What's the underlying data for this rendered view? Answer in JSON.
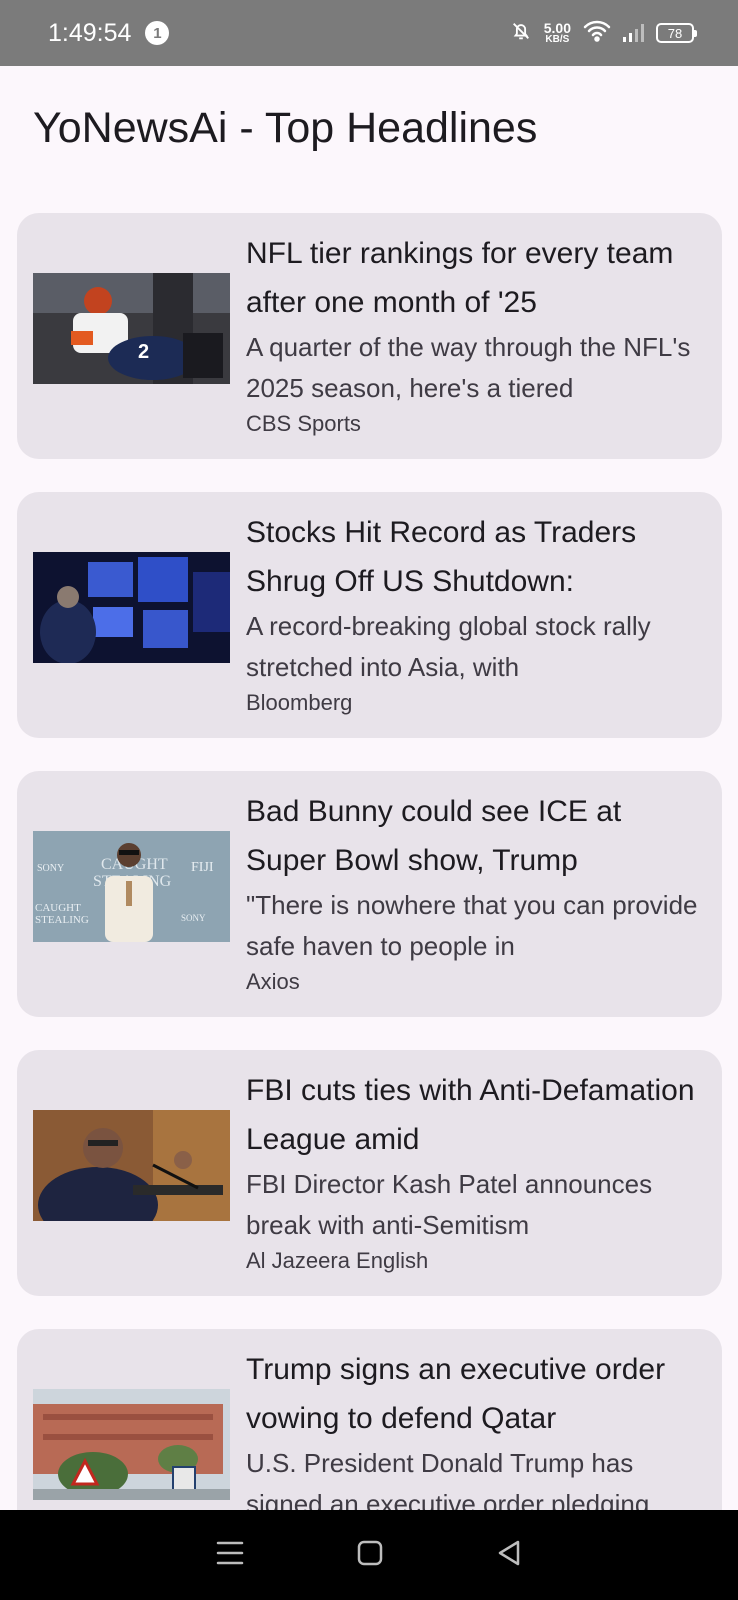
{
  "status_bar": {
    "time": "1:49:54",
    "notification_count": "1",
    "net_speed_value": "5.00",
    "net_speed_unit": "KB/S",
    "battery": "78"
  },
  "app": {
    "title": "YoNewsAi - Top Headlines"
  },
  "articles": [
    {
      "headline": "NFL tier rankings for every team after one month of '25",
      "description": "A quarter of the way through the NFL's 2025 season, here's a tiered",
      "source": "CBS Sports",
      "image": "football-players"
    },
    {
      "headline": "Stocks Hit Record as Traders Shrug Off US Shutdown:",
      "description": "A record-breaking global stock rally stretched into Asia, with",
      "source": "Bloomberg",
      "image": "trading-floor"
    },
    {
      "headline": "Bad Bunny could see ICE at Super Bowl show, Trump",
      "description": "\"There is nowhere that you can provide safe haven to people in",
      "source": "Axios",
      "image": "red-carpet",
      "image_text": {
        "brand_1": "SONY",
        "brand_2": "SONY",
        "brand_3": "FIJI",
        "movie_1": "CAUGHT",
        "movie_2": "STEALING"
      }
    },
    {
      "headline": "FBI cuts ties with Anti-Defamation League amid",
      "description": "FBI Director Kash Patel announces break with anti-Semitism",
      "source": "Al Jazeera English",
      "image": "speaker-at-hearing"
    },
    {
      "headline": "Trump signs an executive order vowing to defend Qatar",
      "description": "U.S. President Donald Trump has signed an executive order pledging",
      "source": "",
      "image": "city-street"
    }
  ],
  "colors": {
    "background": "#fcf7fc",
    "card": "#e8e3ea",
    "status_bar": "#7b7b7b",
    "nav_bar": "#000000"
  }
}
